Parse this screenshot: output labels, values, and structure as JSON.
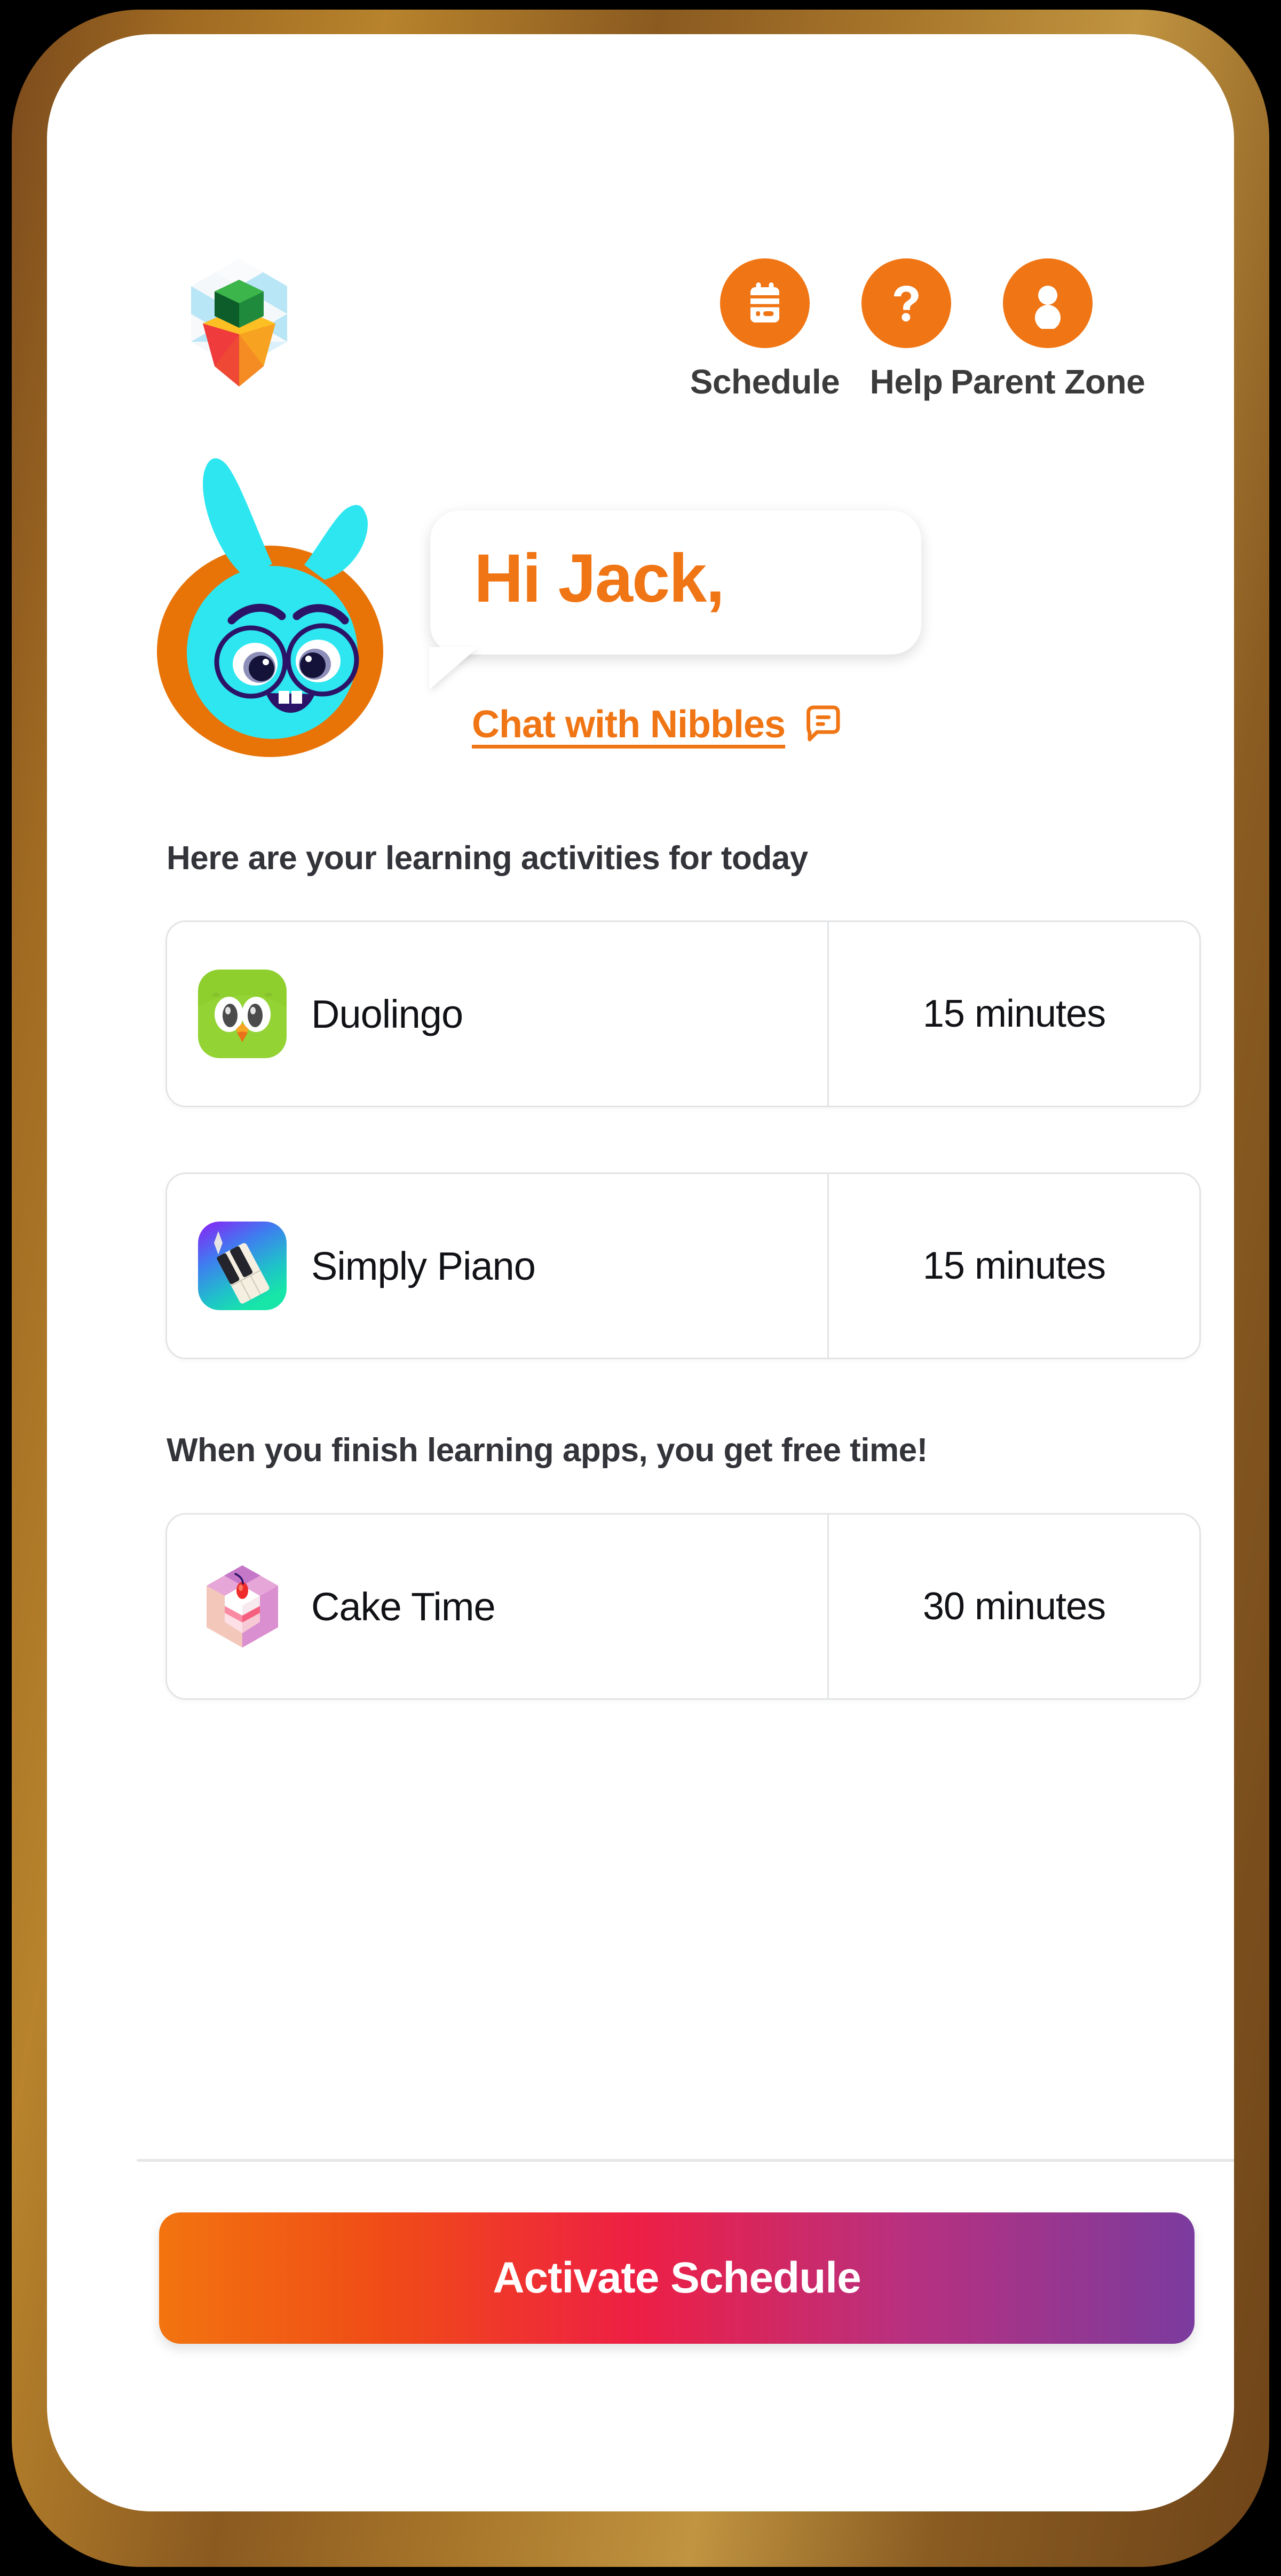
{
  "app": {
    "brand_logo_icon": "isometric-carrot-logo",
    "mascot_name": "Nibbles"
  },
  "header": {
    "nav": [
      {
        "id": "schedule",
        "label": "Schedule",
        "icon": "calendar-icon"
      },
      {
        "id": "help",
        "label": "Help",
        "icon": "question-mark-icon"
      },
      {
        "id": "parent_zone",
        "label": "Parent Zone",
        "icon": "person-icon"
      }
    ]
  },
  "greeting": {
    "text": "Hi Jack,",
    "chat_link_label": "Chat with Nibbles",
    "chat_link_icon": "chat-bubble-icon",
    "mascot_icon": "nibbles-bunny-avatar"
  },
  "sections": {
    "learning_heading": "Here are your learning activities for today",
    "freetime_heading": "When you finish learning apps, you get free time!"
  },
  "learning_activities": [
    {
      "id": "duolingo",
      "name": "Duolingo",
      "duration": "15 minutes",
      "icon": "duolingo-owl-icon"
    },
    {
      "id": "simply_piano",
      "name": "Simply Piano",
      "duration": "15 minutes",
      "icon": "simply-piano-icon"
    }
  ],
  "free_time_activities": [
    {
      "id": "cake_time",
      "name": "Cake Time",
      "duration": "30 minutes",
      "icon": "cake-slice-icon"
    }
  ],
  "footer": {
    "activate_label": "Activate Schedule"
  },
  "colors": {
    "brand_orange": "#f07514",
    "text_dark": "#111216",
    "heading_gray": "#33343a",
    "card_border": "#e3e4e6",
    "button_gradient_start": "#f2740f",
    "button_gradient_mid": "#ee1f44",
    "button_gradient_end": "#7b3b9e",
    "phone_frame_bronze": "#a06a22"
  }
}
